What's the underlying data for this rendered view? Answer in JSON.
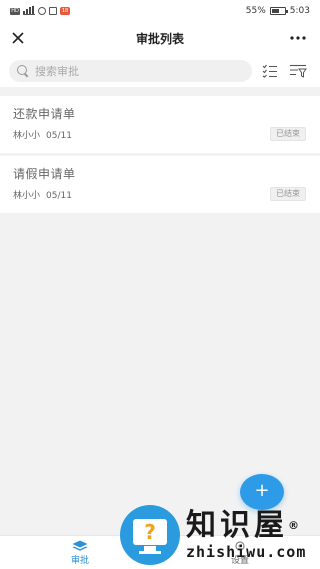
{
  "status_bar": {
    "network_badge": "HD",
    "notification_badge": "18",
    "battery_percent": "55%",
    "time": "5:03"
  },
  "header": {
    "title": "审批列表",
    "close_icon": "close-icon",
    "more_icon": "more-icon"
  },
  "search": {
    "placeholder": "搜索审批",
    "value": ""
  },
  "cards": [
    {
      "title": "还款申请单",
      "applicant": "林小小",
      "date": "05/11",
      "status": "已结束"
    },
    {
      "title": "请假申请单",
      "applicant": "林小小",
      "date": "05/11",
      "status": "已结束"
    }
  ],
  "fab": {
    "label": "+"
  },
  "bottom_nav": [
    {
      "label": "审批",
      "icon": "layers-icon",
      "active": true
    },
    {
      "label": "设置",
      "icon": "gear-icon",
      "active": false
    }
  ],
  "watermark": {
    "brand": "知识屋",
    "domain": "zhishiwu.com",
    "reg_mark": "®"
  },
  "colors": {
    "accent": "#2d9be8",
    "nav_active": "#2d8fd5",
    "background": "#f2f2f2"
  }
}
